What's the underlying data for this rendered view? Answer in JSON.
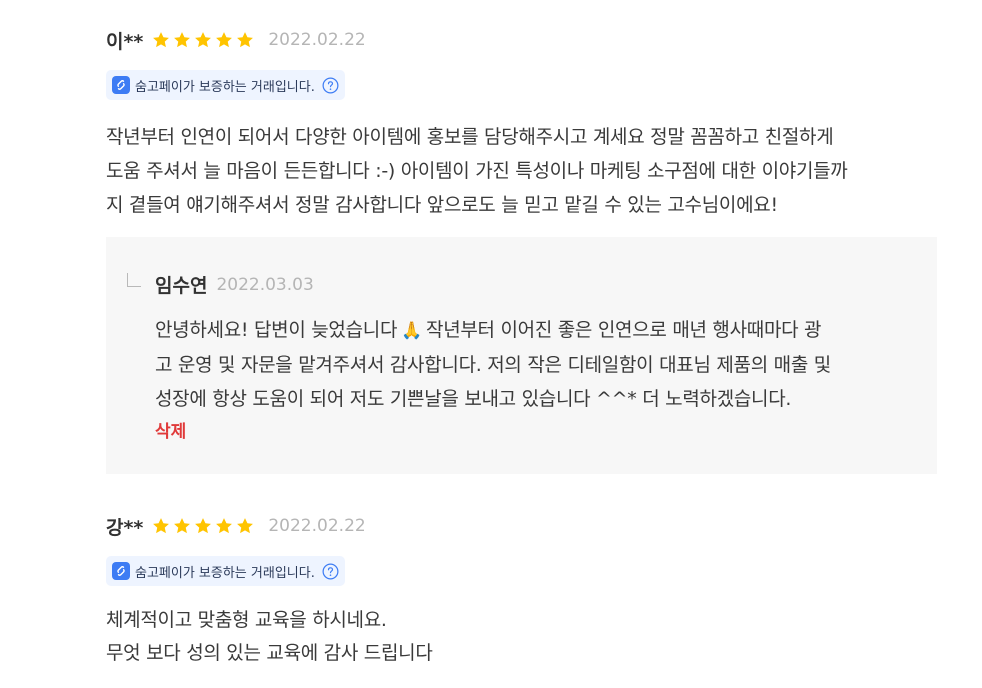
{
  "reviews": [
    {
      "author": "이**",
      "rating": 5,
      "date": "2022.02.22",
      "badge": {
        "label": "숨고페이가 보증하는 거래입니다.",
        "icon": "soomgo-pay-icon"
      },
      "body_lines": [
        "작년부터 인연이 되어서 다양한 아이템에 홍보를 담당해주시고 계세요 정말 꼼꼼하고 친절하게",
        "도움 주셔서 늘 마음이 든든합니다 :-) 아이템이 가진 특성이나 마케팅 소구점에 대한 이야기들까",
        "지 곁들여 얘기해주셔서 정말 감사합니다 앞으로도 늘 믿고 맡길 수 있는 고수님이에요!"
      ],
      "reply": {
        "author": "임수연",
        "date": "2022.03.03",
        "line1_before_emoji": "안녕하세요! 답변이 늦었습니다",
        "emoji": "🙏",
        "line1_after_emoji": "작년부터 이어진 좋은 인연으로 매년 행사때마다 광",
        "line2": "고 운영 및 자문을 맡겨주셔서 감사합니다. 저의 작은 디테일함이 대표님 제품의 매출 및",
        "line3": "성장에 항상 도움이 되어 저도 기쁜날을 보내고 있습니다 ^^* 더 노력하겠습니다.",
        "delete_label": "삭제"
      }
    },
    {
      "author": "강**",
      "rating": 5,
      "date": "2022.02.22",
      "badge": {
        "label": "숨고페이가 보증하는 거래입니다.",
        "icon": "soomgo-pay-icon"
      },
      "body_lines": [
        "체계적이고 맞춤형 교육을 하시네요.",
        "무엇 보다 성의 있는 교육에 감사 드립니다"
      ]
    }
  ],
  "colors": {
    "star": "#ffc400",
    "badge_bg": "#eef4ff",
    "badge_logo": "#3d7cf4",
    "help_icon": "#3d7cf4",
    "delete": "#e03a3a",
    "reply_bg": "#f7f7f7"
  }
}
